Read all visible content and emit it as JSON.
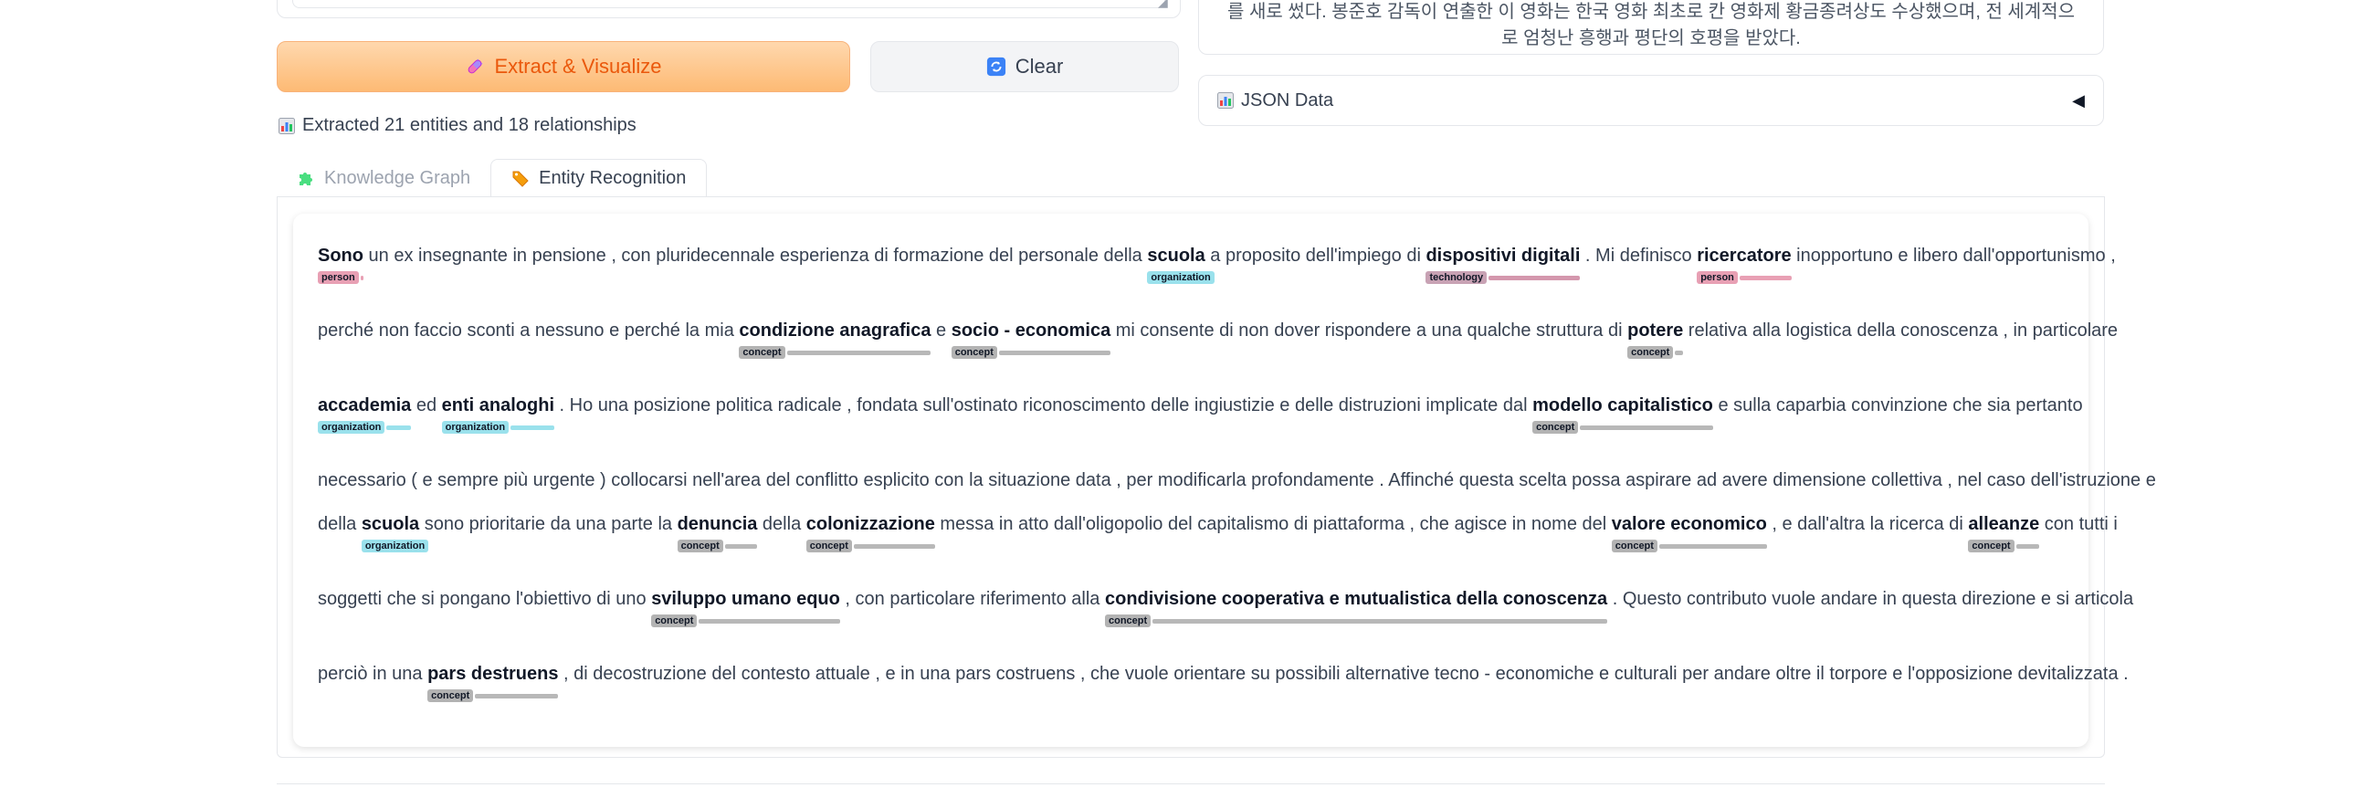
{
  "buttons": {
    "extract_label": "Extract & Visualize",
    "clear_label": "Clear"
  },
  "status": {
    "text": "Extracted 21 entities and 18 relationships"
  },
  "result_text": {
    "line1": "를 새로 썼다. 봉준호 감독이 연출한 이 영화는 한국 영화 최초로 칸 영화제 황금종려상도 수상했으며, 전 세계적으",
    "line2": "로 엄청난 흥행과 평단의 호평을 받았다."
  },
  "json_panel": {
    "label": "JSON Data",
    "arrow": "◀"
  },
  "tabs": [
    {
      "label": "Knowledge Graph",
      "active": false
    },
    {
      "label": "Entity Recognition",
      "active": true
    }
  ],
  "entity_text": {
    "lines": [
      [
        {
          "t": "Sono",
          "e": "person"
        },
        {
          "t": " un ex insegnante in pensione , con pluridecennale esperienza di formazione del personale della "
        },
        {
          "t": "scuola",
          "e": "organization"
        },
        {
          "t": " a proposito dell'impiego di "
        },
        {
          "t": "dispositivi digitali",
          "e": "technology"
        },
        {
          "t": " . Mi definisco "
        },
        {
          "t": "ricercatore",
          "e": "person"
        },
        {
          "t": " inopportuno e libero dall'opportunismo ,"
        }
      ],
      [
        {
          "t": "perché non faccio sconti a nessuno e perché la mia "
        },
        {
          "t": "condizione anagrafica",
          "e": "concept"
        },
        {
          "t": " e "
        },
        {
          "t": "socio - economica",
          "e": "concept"
        },
        {
          "t": " mi consente di non dover rispondere a una qualche struttura di "
        },
        {
          "t": "potere",
          "e": "concept"
        },
        {
          "t": " relativa alla logistica della conoscenza , in particolare"
        }
      ],
      [
        {
          "t": "accademia",
          "e": "organization"
        },
        {
          "t": " ed "
        },
        {
          "t": "enti analoghi",
          "e": "organization"
        },
        {
          "t": " . Ho una posizione politica radicale , fondata sull'ostinato riconoscimento delle ingiustizie e delle distruzioni implicate dal "
        },
        {
          "t": "modello capitalistico",
          "e": "concept"
        },
        {
          "t": " e sulla caparbia convinzione che sia pertanto"
        }
      ],
      [
        {
          "t": "necessario ( e sempre più urgente ) collocarsi nell'area del conflitto esplicito con la situazione data , per modificarla profondamente . Affinché questa scelta possa aspirare ad avere dimensione collettiva , nel caso dell'istruzione e"
        }
      ],
      [
        {
          "t": "della "
        },
        {
          "t": "scuola",
          "e": "organization"
        },
        {
          "t": " sono prioritarie da una parte la "
        },
        {
          "t": "denuncia",
          "e": "concept"
        },
        {
          "t": " della "
        },
        {
          "t": "colonizzazione",
          "e": "concept"
        },
        {
          "t": " messa in atto dall'oligopolio del capitalismo di piattaforma , che agisce in nome del "
        },
        {
          "t": "valore economico",
          "e": "concept"
        },
        {
          "t": " , e dall'altra la ricerca di "
        },
        {
          "t": "alleanze",
          "e": "concept"
        },
        {
          "t": " con tutti i"
        }
      ],
      [
        {
          "t": "soggetti che si pongano l'obiettivo di uno "
        },
        {
          "t": "sviluppo umano equo",
          "e": "concept"
        },
        {
          "t": " , con particolare riferimento alla "
        },
        {
          "t": "condivisione cooperativa e mutualistica della conoscenza",
          "e": "concept"
        },
        {
          "t": " . Questo contributo vuole andare in questa direzione e si articola"
        }
      ],
      [
        {
          "t": "perciò in una "
        },
        {
          "t": "pars destruens",
          "e": "concept"
        },
        {
          "t": " , di decostruzione del contesto attuale , e in una pars costruens , che vuole orientare su possibili alternative tecno - economiche e culturali per andare oltre il torpore e l'opposizione devitalizzata ."
        }
      ]
    ]
  },
  "colors": {
    "primary_button_text": "#ea580c",
    "person": "#e8a0b4",
    "organization": "#9ae1ec",
    "technology": "#c8a2b4",
    "concept": "#b3b3b3"
  }
}
